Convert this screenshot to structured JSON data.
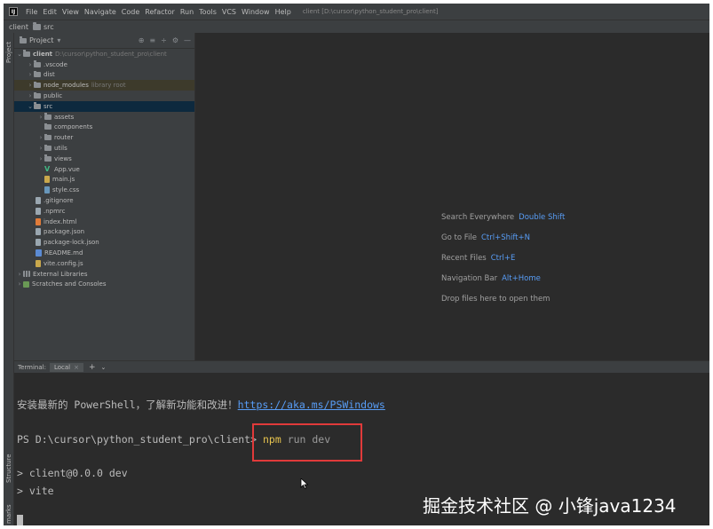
{
  "menubar": {
    "logo": "IJ",
    "items": [
      "File",
      "Edit",
      "View",
      "Navigate",
      "Code",
      "Refactor",
      "Run",
      "Tools",
      "VCS",
      "Window",
      "Help"
    ],
    "title": "client [D:\\cursor\\python_student_pro\\client]"
  },
  "breadcrumb": {
    "root": "client",
    "child": "src"
  },
  "side_tools": {
    "project": "Project",
    "structure": "Structure",
    "bookmarks": "marks"
  },
  "project_panel": {
    "title": "Project",
    "rows": [
      {
        "name": "client",
        "hint": "D:\\cursor\\python_student_pro\\client"
      },
      {
        "name": ".vscode"
      },
      {
        "name": "dist"
      },
      {
        "name": "node_modules",
        "hint": "library root"
      },
      {
        "name": "public"
      },
      {
        "name": "src"
      },
      {
        "name": "assets"
      },
      {
        "name": "components"
      },
      {
        "name": "router"
      },
      {
        "name": "utils"
      },
      {
        "name": "views"
      },
      {
        "name": "App.vue"
      },
      {
        "name": "main.js"
      },
      {
        "name": "style.css"
      },
      {
        "name": ".gitignore"
      },
      {
        "name": ".npmrc"
      },
      {
        "name": "index.html"
      },
      {
        "name": "package.json"
      },
      {
        "name": "package-lock.json"
      },
      {
        "name": "README.md"
      },
      {
        "name": "vite.config.js"
      },
      {
        "name": "External Libraries"
      },
      {
        "name": "Scratches and Consoles"
      }
    ]
  },
  "editor_tips": [
    {
      "label": "Search Everywhere",
      "key": "Double Shift"
    },
    {
      "label": "Go to File",
      "key": "Ctrl+Shift+N"
    },
    {
      "label": "Recent Files",
      "key": "Ctrl+E"
    },
    {
      "label": "Navigation Bar",
      "key": "Alt+Home"
    },
    {
      "label": "Drop files here to open them",
      "key": ""
    }
  ],
  "terminal_tabs": {
    "title": "Terminal:",
    "local": "Local",
    "close": "×",
    "add": "+",
    "more": "⌄"
  },
  "terminal": {
    "notice_text": "安装最新的 PowerShell，了解新功能和改进！",
    "notice_link": "https://aka.ms/PSWindows",
    "prompt": "PS D:\\cursor\\python_student_pro\\client>",
    "command": "npm",
    "command_args": "run dev",
    "output1": "> client@0.0.0 dev",
    "output2": "> vite"
  },
  "watermark": "掘金技术社区 @ 小锋java1234"
}
